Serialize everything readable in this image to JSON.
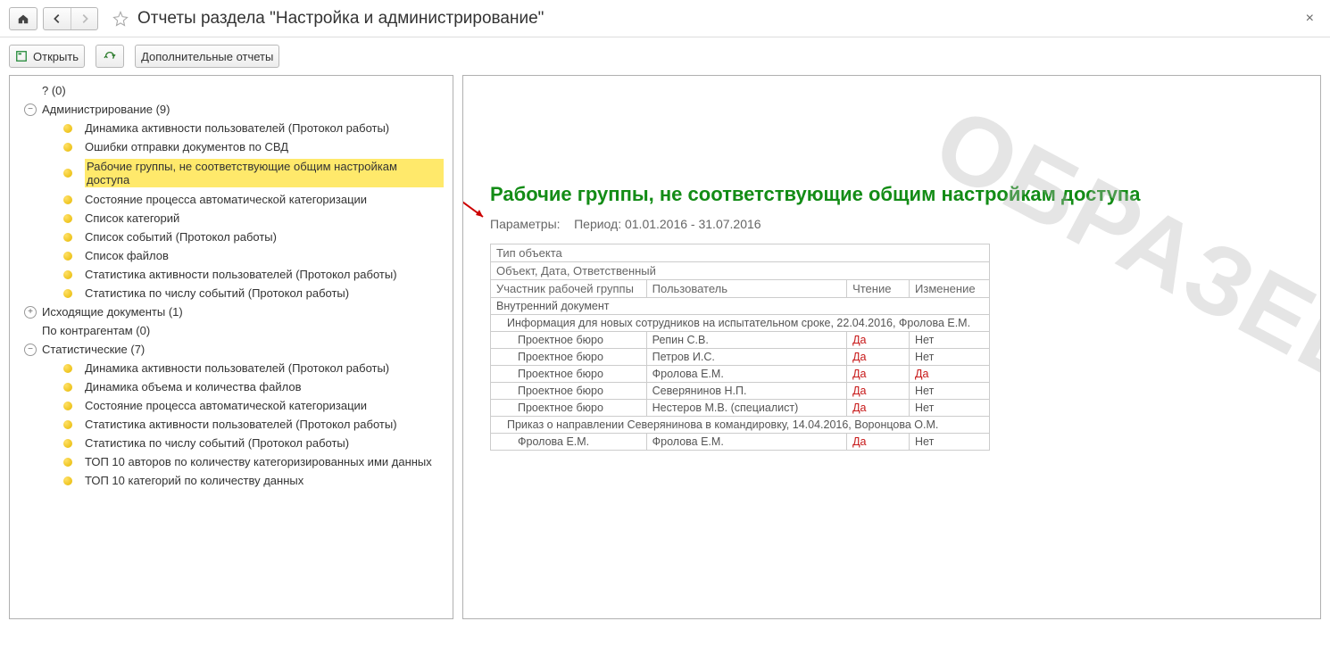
{
  "header": {
    "title": "Отчеты раздела \"Настройка и администрирование\""
  },
  "toolbar": {
    "open": "Открыть",
    "extra": "Дополнительные отчеты"
  },
  "tree": {
    "g0": {
      "label": "? (0)"
    },
    "g1": {
      "label": "Администрирование (9)",
      "items": [
        "Динамика активности пользователей (Протокол работы)",
        "Ошибки отправки документов по СВД",
        "Рабочие группы, не соответствующие общим настройкам доступа",
        "Состояние процесса автоматической категоризации",
        "Список категорий",
        "Список событий (Протокол работы)",
        "Список файлов",
        "Статистика активности пользователей (Протокол работы)",
        "Статистика по числу событий (Протокол работы)"
      ]
    },
    "g2": {
      "label": "Исходящие документы (1)"
    },
    "g3": {
      "label": "По контрагентам (0)"
    },
    "g4": {
      "label": "Статистические (7)",
      "items": [
        "Динамика активности пользователей (Протокол работы)",
        "Динамика объема и количества файлов",
        "Состояние процесса автоматической категоризации",
        "Статистика активности пользователей (Протокол работы)",
        "Статистика по числу событий (Протокол работы)",
        "ТОП 10 авторов по количеству категоризированных ими данных",
        "ТОП 10 категорий по количеству данных"
      ]
    }
  },
  "report": {
    "title": "Рабочие группы, не соответствующие общим настройкам доступа",
    "params_label": "Параметры:",
    "period": "Период: 01.01.2016 - 31.07.2016",
    "hdr": {
      "c1": "Тип объекта",
      "c2": "Объект, Дата, Ответственный",
      "c3": "Участник рабочей группы",
      "c4": "Пользователь",
      "c5": "Чтение",
      "c6": "Изменение"
    },
    "sec1": "Внутренний документ",
    "sec1a": "Информация для новых сотрудников на испытательном сроке, 22.04.2016, Фролова Е.М.",
    "rows1": [
      {
        "g": "Проектное бюро",
        "u": "Репин С.В.",
        "r": "Да",
        "w": "Нет"
      },
      {
        "g": "Проектное бюро",
        "u": "Петров И.С.",
        "r": "Да",
        "w": "Нет"
      },
      {
        "g": "Проектное бюро",
        "u": "Фролова Е.М.",
        "r": "Да",
        "w": "Да"
      },
      {
        "g": "Проектное бюро",
        "u": "Северянинов Н.П.",
        "r": "Да",
        "w": "Нет"
      },
      {
        "g": "Проектное бюро",
        "u": "Нестеров М.В. (специалист)",
        "r": "Да",
        "w": "Нет"
      }
    ],
    "sec1b": "Приказ о направлении Северянинова в командировку, 14.04.2016, Воронцова О.М.",
    "rows2": [
      {
        "g": "Фролова Е.М.",
        "u": "Фролова Е.М.",
        "r": "Да",
        "w": "Нет"
      }
    ]
  },
  "watermark": "ОБРАЗЕЦ"
}
